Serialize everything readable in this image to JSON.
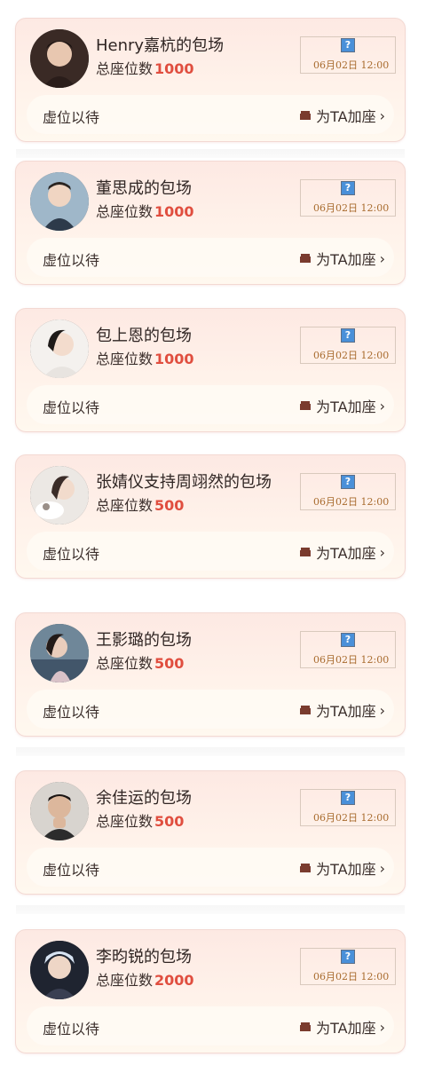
{
  "cards": [
    {
      "title": "Henry嘉杭的包场",
      "seat_label": "总座位数",
      "seat_count": "1000",
      "time": "06月02日 12:00",
      "status": "虚位以待",
      "join_label": "为TA加座"
    },
    {
      "title": "董思成的包场",
      "seat_label": "总座位数",
      "seat_count": "1000",
      "time": "06月02日 12:00",
      "status": "虚位以待",
      "join_label": "为TA加座"
    },
    {
      "title": "包上恩的包场",
      "seat_label": "总座位数",
      "seat_count": "1000",
      "time": "06月02日 12:00",
      "status": "虚位以待",
      "join_label": "为TA加座"
    },
    {
      "title": "张婧仪支持周翊然的包场",
      "seat_label": "总座位数",
      "seat_count": "500",
      "time": "06月02日 12:00",
      "status": "虚位以待",
      "join_label": "为TA加座"
    },
    {
      "title": "王影璐的包场",
      "seat_label": "总座位数",
      "seat_count": "500",
      "time": "06月02日 12:00",
      "status": "虚位以待",
      "join_label": "为TA加座"
    },
    {
      "title": "余佳运的包场",
      "seat_label": "总座位数",
      "seat_count": "500",
      "time": "06月02日 12:00",
      "status": "虚位以待",
      "join_label": "为TA加座"
    },
    {
      "title": "李昀锐的包场",
      "seat_label": "总座位数",
      "seat_count": "2000",
      "time": "06月02日 12:00",
      "status": "虚位以待",
      "join_label": "为TA加座"
    }
  ],
  "icons": {
    "broken_image": "broken-image-icon",
    "sofa": "sofa-icon",
    "chevron": "chevron-right-icon"
  },
  "colors": {
    "seat_count": "#e04e3f",
    "time": "#a86b2e",
    "card_bg": "#fde9e3"
  }
}
